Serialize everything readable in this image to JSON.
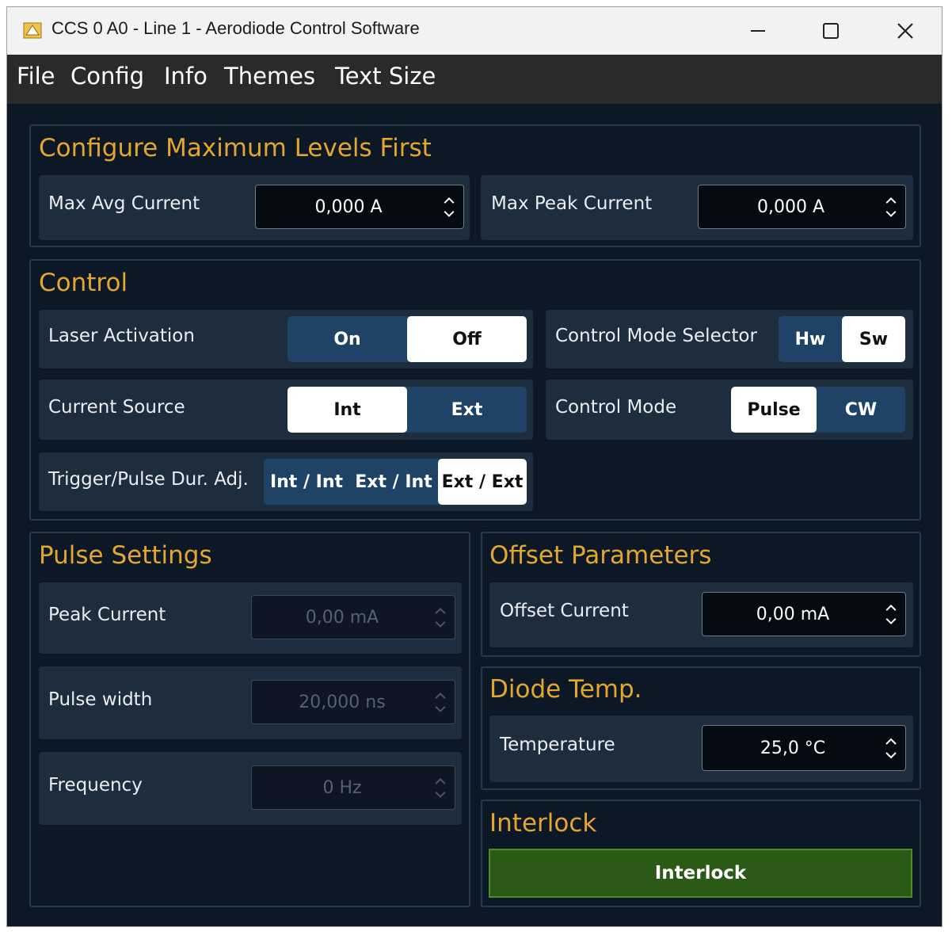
{
  "window": {
    "title": "CCS 0 A0 - Line 1 - Aerodiode Control Software",
    "icon": "app-logo-icon"
  },
  "menu": [
    "File",
    "Config",
    "Info",
    "Themes",
    "Text Size"
  ],
  "max_levels": {
    "title": "Configure Maximum Levels First",
    "avg_label": "Max Avg Current",
    "avg_value": "0,000 A",
    "peak_label": "Max Peak Current",
    "peak_value": "0,000 A"
  },
  "control": {
    "title": "Control",
    "laser_label": "Laser Activation",
    "laser_options": [
      "On",
      "Off"
    ],
    "laser_selected": "Off",
    "mode_selector_label": "Control Mode Selector",
    "mode_selector_options": [
      "Hw",
      "Sw"
    ],
    "mode_selector_selected": "Sw",
    "source_label": "Current Source",
    "source_options": [
      "Int",
      "Ext"
    ],
    "source_selected": "Int",
    "mode_label": "Control Mode",
    "mode_options": [
      "Pulse",
      "CW"
    ],
    "mode_selected": "Pulse",
    "trigger_label": "Trigger/Pulse Dur. Adj.",
    "trigger_options": [
      "Int / Int",
      "Ext / Int",
      "Ext / Ext"
    ],
    "trigger_selected": "Ext / Ext"
  },
  "pulse": {
    "title": "Pulse Settings",
    "peak_label": "Peak Current",
    "peak_value": "0,00 mA",
    "width_label": "Pulse width",
    "width_value": "20,000 ns",
    "freq_label": "Frequency",
    "freq_value": "0 Hz"
  },
  "offset": {
    "title": "Offset Parameters",
    "current_label": "Offset Current",
    "current_value": "0,00 mA"
  },
  "diode": {
    "title": "Diode Temp.",
    "temp_label": "Temperature",
    "temp_value": "25,0 °C"
  },
  "interlock": {
    "title": "Interlock",
    "button_label": "Interlock"
  },
  "colors": {
    "background": "#0d1826",
    "accent_title": "#e3a62e",
    "toggle_inactive": "#1f4366",
    "toggle_active": "#ffffff",
    "interlock_green": "#2b5a17"
  }
}
